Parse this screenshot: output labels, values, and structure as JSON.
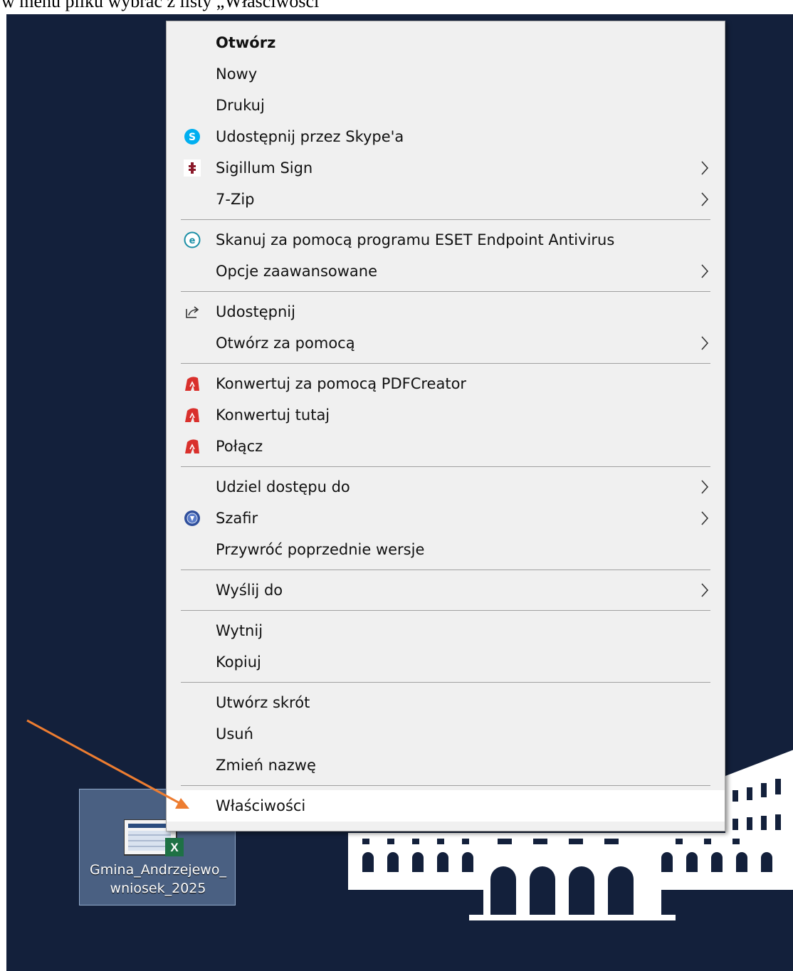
{
  "document": {
    "top_text": "w menu pliku wybrać z listy „Właściwości”"
  },
  "desktop": {
    "background_color": "#13203b",
    "file": {
      "name_line1": "Gmina_Andrzejewo_",
      "name_line2": "wniosek_2025",
      "icon": "excel-file-icon"
    }
  },
  "context_menu": {
    "groups": [
      [
        {
          "label": "Otwórz",
          "bold": true,
          "icon": null,
          "submenu": false
        },
        {
          "label": "Nowy",
          "icon": null,
          "submenu": false
        },
        {
          "label": "Drukuj",
          "icon": null,
          "submenu": false
        },
        {
          "label": "Udostępnij przez Skype'a",
          "icon": "skype-icon",
          "submenu": false
        },
        {
          "label": "Sigillum Sign",
          "icon": "sigillum-icon",
          "submenu": true
        },
        {
          "label": "7-Zip",
          "icon": null,
          "submenu": true
        }
      ],
      [
        {
          "label": "Skanuj za pomocą programu ESET Endpoint Antivirus",
          "icon": "eset-icon",
          "submenu": false
        },
        {
          "label": "Opcje zaawansowane",
          "icon": null,
          "submenu": true
        }
      ],
      [
        {
          "label": "Udostępnij",
          "icon": "share-icon",
          "submenu": false
        },
        {
          "label": "Otwórz za pomocą",
          "icon": null,
          "submenu": true
        }
      ],
      [
        {
          "label": "Konwertuj za pomocą PDFCreator",
          "icon": "pdfcreator-icon",
          "submenu": false
        },
        {
          "label": "Konwertuj tutaj",
          "icon": "pdfcreator-icon",
          "submenu": false
        },
        {
          "label": "Połącz",
          "icon": "pdfcreator-icon",
          "submenu": false
        }
      ],
      [
        {
          "label": "Udziel dostępu do",
          "icon": null,
          "submenu": true
        },
        {
          "label": "Szafir",
          "icon": "szafir-icon",
          "submenu": true
        },
        {
          "label": "Przywróć poprzednie wersje",
          "icon": null,
          "submenu": false
        }
      ],
      [
        {
          "label": "Wyślij do",
          "icon": null,
          "submenu": true
        }
      ],
      [
        {
          "label": "Wytnij",
          "icon": null,
          "submenu": false
        },
        {
          "label": "Kopiuj",
          "icon": null,
          "submenu": false
        }
      ],
      [
        {
          "label": "Utwórz skrót",
          "icon": null,
          "submenu": false
        },
        {
          "label": "Usuń",
          "icon": null,
          "submenu": false
        },
        {
          "label": "Zmień nazwę",
          "icon": null,
          "submenu": false
        }
      ],
      [
        {
          "label": "Właściwości",
          "icon": null,
          "submenu": false,
          "highlighted": true
        }
      ]
    ]
  },
  "annotation": {
    "arrow_color": "#ed7d31",
    "points_to": "Właściwości"
  }
}
